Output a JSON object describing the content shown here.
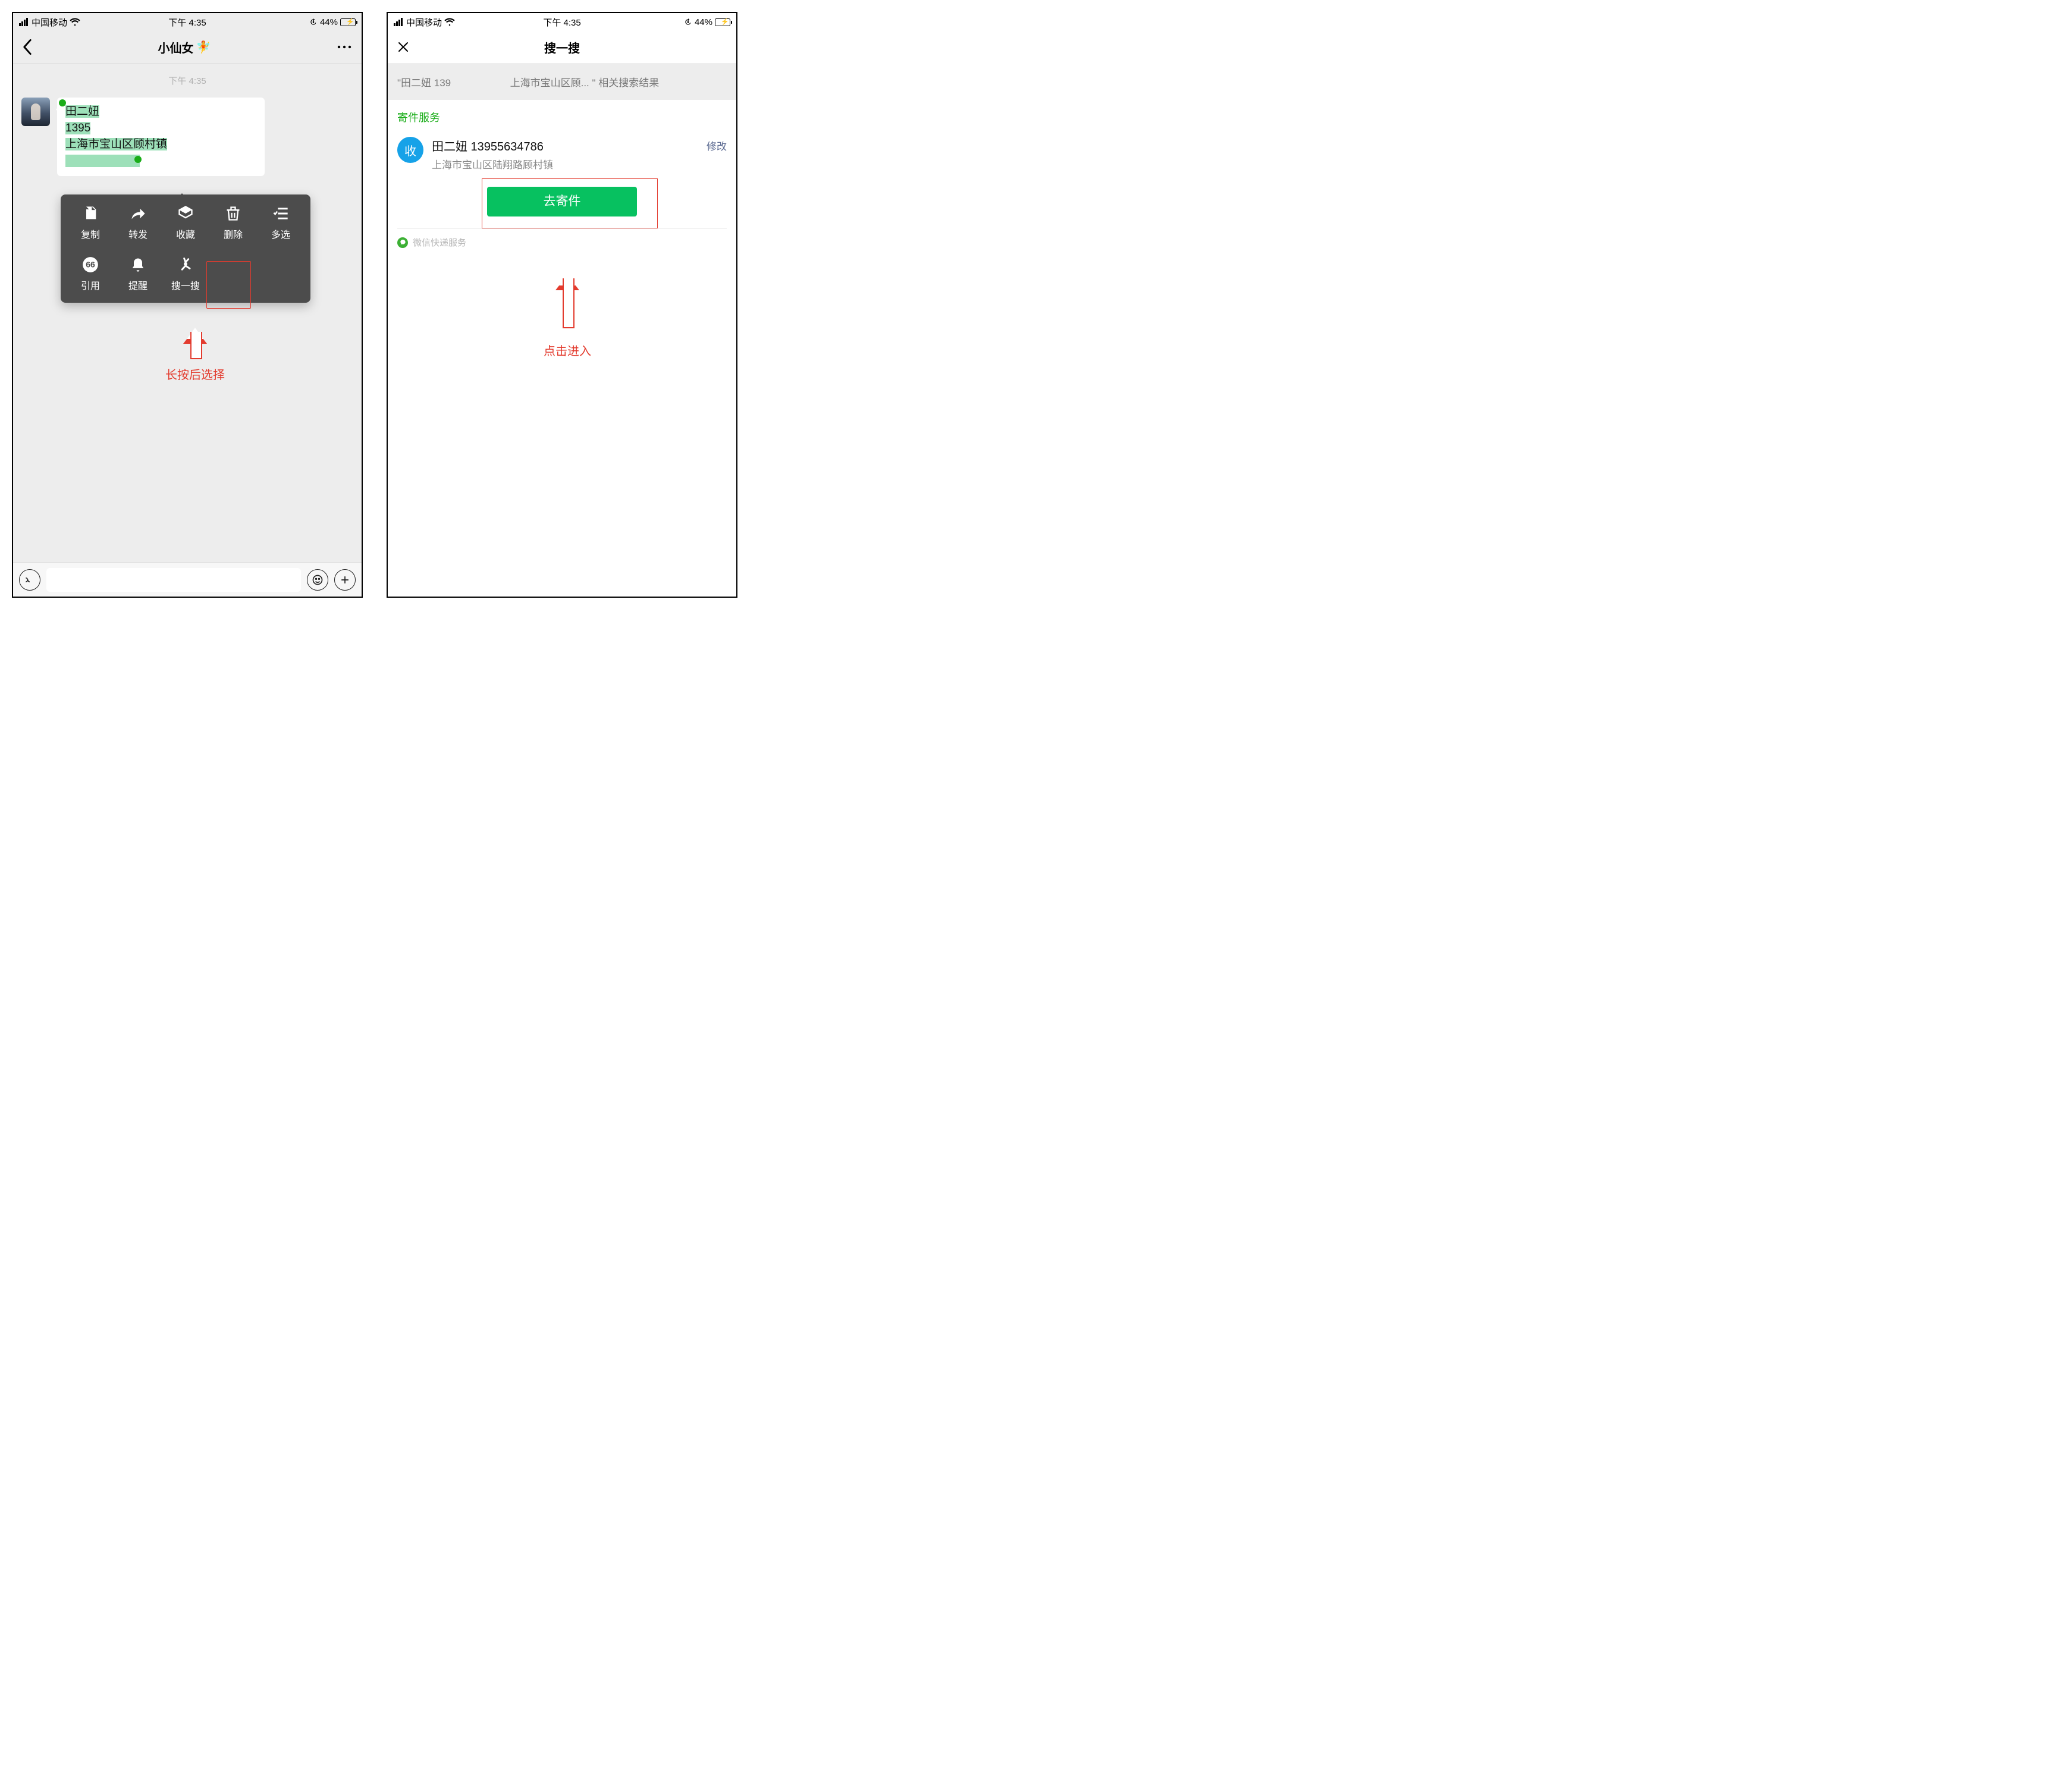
{
  "status": {
    "carrier": "中国移动",
    "time": "下午 4:35",
    "battery_pct": "44%"
  },
  "left": {
    "nav_title": "小仙女",
    "chat_time": "下午 4:35",
    "msg": {
      "name": "田二妞",
      "phone_prefix": "1395",
      "addr_prefix": "上海市宝山区顾村镇"
    },
    "ctx": {
      "copy": "复制",
      "forward": "转发",
      "favorite": "收藏",
      "delete": "删除",
      "multi": "多选",
      "quote": "引用",
      "remind": "提醒",
      "search": "搜一搜"
    },
    "caption": "长按后选择"
  },
  "right": {
    "nav_title": "搜一搜",
    "search_summary_prefix": "\"田二妞 139",
    "search_summary_mid": "上海市宝山区顾... \"",
    "search_summary_suffix": "相关搜索结果",
    "section": "寄件服务",
    "badge": "收",
    "result_line1": "田二妞 13955634786",
    "result_line2": "上海市宝山区陆翔路顾村镇",
    "modify": "修改",
    "go_btn": "去寄件",
    "provider": "微信快递服务",
    "caption": "点击进入"
  }
}
